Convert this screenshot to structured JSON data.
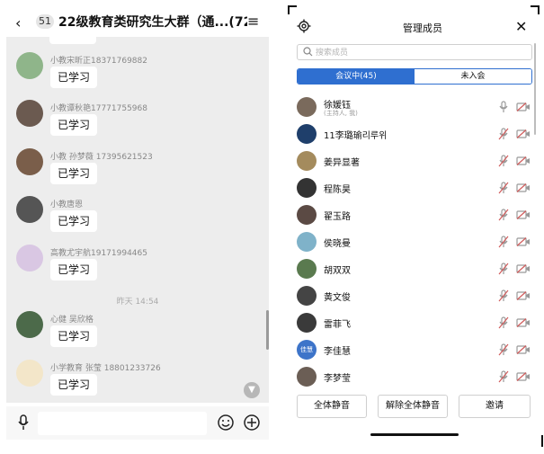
{
  "chat": {
    "header": {
      "back_icon": "‹",
      "badge": "51",
      "title": "22级教育类研究生大群（通...(72)",
      "menu_icon": "≡"
    },
    "messages": [
      {
        "name": "小教宋昕正18371769882",
        "text": "已学习"
      },
      {
        "name": "小教谭秋艳17771755968",
        "text": "已学习"
      },
      {
        "name": "小教 孙梦薇 17395621523",
        "text": "已学习"
      },
      {
        "name": "小教唐恩",
        "text": "已学习"
      },
      {
        "name": "高教尤宇航19171994465",
        "text": "已学习"
      }
    ],
    "time_divider": "昨天 14:54",
    "messages2": [
      {
        "name": "心健 吴欣格",
        "text": "已学习"
      },
      {
        "name": "小学教育 张莹 18801233726",
        "text": "已学习"
      }
    ]
  },
  "members": {
    "title": "管理成员",
    "search_placeholder": "搜索成员",
    "tabs": {
      "active": "会议中(45)",
      "inactive": "未入会"
    },
    "list": [
      {
        "name": "徐媛钰",
        "sub": "(主持人, 我)"
      },
      {
        "name": "11李璐瑜리루위"
      },
      {
        "name": "姜异显著"
      },
      {
        "name": "程陈昊"
      },
      {
        "name": "翟玉路"
      },
      {
        "name": "侯晓曼"
      },
      {
        "name": "胡双双"
      },
      {
        "name": "黄文俊"
      },
      {
        "name": "雷菲飞"
      },
      {
        "name": "李佳慧",
        "avatar_text": "佳慧"
      },
      {
        "name": "李梦莹"
      }
    ],
    "buttons": {
      "mute_all": "全体静音",
      "unmute_all": "解除全体静音",
      "invite": "邀请"
    }
  },
  "colors": {
    "accent": "#2f6fd0",
    "muted_red": "#d05a5a"
  }
}
